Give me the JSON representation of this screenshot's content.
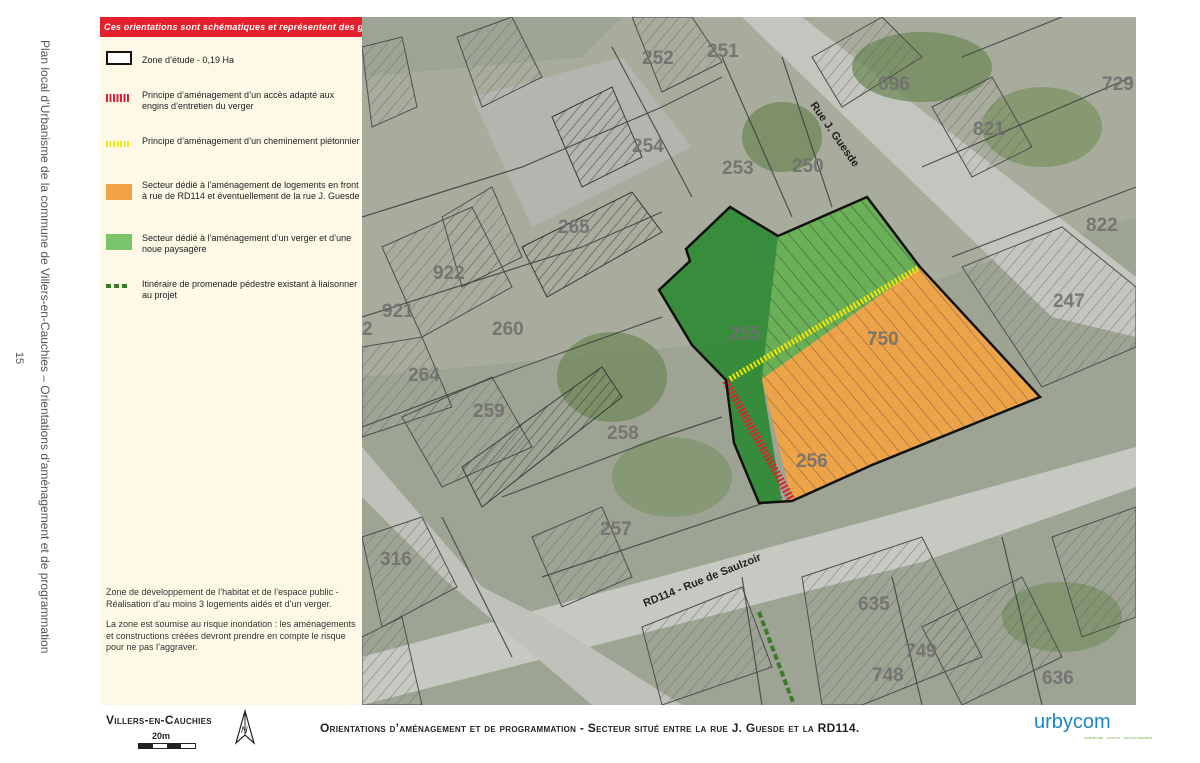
{
  "side": {
    "running_title": "Plan local d’Urbanisme de la commune de Villers-en-Cauchies – Orientations d’aménagement et de programmation",
    "page_number": "15"
  },
  "banner": "Ces orientations sont schématiques et représentent des grands principes d’aménagement à respecter.",
  "legend": [
    {
      "key": "zone-etude",
      "label": "Zone d’étude - 0,19 Ha",
      "swatch": "outline",
      "color": "#111111"
    },
    {
      "key": "acces-verger",
      "label": "Principe d’aménagement d’un accès adapté aux engins d’entretien du verger",
      "swatch": "hatched-red",
      "color": "#d9232d"
    },
    {
      "key": "cheminement",
      "label": "Principe d’aménagement d’un cheminement piétonnier",
      "swatch": "hatched-yellow",
      "color": "#f4e600"
    },
    {
      "key": "logements",
      "label": "Secteur dédié à l’aménagement de logements en front à rue de RD114 et éventuellement de la rue J. Guesde",
      "swatch": "fill",
      "color": "#f2a444"
    },
    {
      "key": "verger",
      "label": "Secteur dédié à l’aménagement d’un verger et d’une noue paysagère",
      "swatch": "fill",
      "color": "#7cc46a"
    },
    {
      "key": "promenade",
      "label": "Itinéraire de promenade pédestre existant à liaisonner au projet",
      "swatch": "dashed-green",
      "color": "#3d7a2a"
    }
  ],
  "notes": [
    "Zone de développement de l’habitat et de l’espace public - Réalisation d’au moins 3 logements aidés et d’un verger.",
    "La zone est soumise au risque inondation : les aménagements et constructions créées devront prendre en compte le risque pour ne pas l’aggraver."
  ],
  "map": {
    "parcels": [
      "252",
      "251",
      "696",
      "729",
      "254",
      "253",
      "250",
      "821",
      "822",
      "265",
      "922",
      "921",
      "247",
      "260",
      "255",
      "750",
      "264",
      "259",
      "258",
      "256",
      "257",
      "316",
      "635",
      "749",
      "748",
      "636",
      "2"
    ],
    "streets": [
      "Rue J. Guesde",
      "RD114 - Rue de Saulzoir"
    ],
    "colors": {
      "orchard_dark": "#2f8a34",
      "orchard_light": "#63b04f",
      "housing": "#f2a444",
      "outline": "#111111"
    }
  },
  "footer": {
    "commune": "Villers-en-Cauchies",
    "scale_label": "20m",
    "north_label": "N",
    "title": "Orientations d’aménagement et de programmation - Secteur situé entre la rue J. Guesde et la RD114.",
    "logo_text": "urbycom",
    "logo_tagline": "URBANISME · HABITAT · ENVIRONNEMENT"
  }
}
